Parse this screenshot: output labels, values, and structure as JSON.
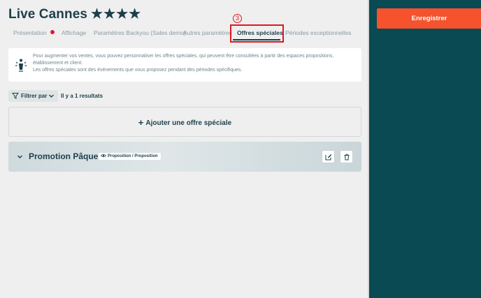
{
  "header": {
    "title": "Live Cannes",
    "stars": "★★★★"
  },
  "tabs": [
    {
      "label": "Présentation",
      "has_alert_dot": true
    },
    {
      "label": "Affichage"
    },
    {
      "label": "Paramètres Backyou (Sales demo)"
    },
    {
      "label": "Autres paramètres"
    },
    {
      "label": "Offres spéciales",
      "active": true
    },
    {
      "label": "Périodes exceptionnelles"
    }
  ],
  "annotation": {
    "step_number": "3"
  },
  "info": {
    "line1": "Pour augmenter vos ventes, vous pouvez personnaliser les offres spéciales, qui peuvent être consultées à partir des espaces propositions, établissement et client.",
    "line2": "Les offres spéciales sont des événements que vous proposez pendant des périodes spécifiques.",
    "icon": "megaphone-icon"
  },
  "filter": {
    "label": "Filtrer par",
    "results_text": "Il y a 1 resultats"
  },
  "add_offer": {
    "label": "Ajouter une offre spéciale"
  },
  "offers": [
    {
      "title": "Promotion Pâques",
      "visibility_badge": "Proposition / Proposition"
    }
  ],
  "sidebar": {
    "save_label": "Enregistrer"
  },
  "colors": {
    "primary_dark": "#1d3f4a",
    "right_panel": "#0a4a52",
    "save_button": "#f5522d",
    "alert_dot": "#e0173b",
    "highlight": "#e0161f"
  }
}
